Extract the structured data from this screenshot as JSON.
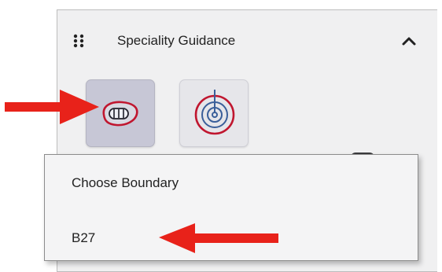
{
  "panel": {
    "title": "Speciality Guidance",
    "drag_icon": "drag-handle-icon",
    "collapse_icon": "chevron-up-icon"
  },
  "tools": [
    {
      "name": "boundary-tool",
      "icon": "boundary-shape-icon",
      "selected": true
    },
    {
      "name": "target-tool",
      "icon": "target-icon",
      "selected": false
    }
  ],
  "dropdown": {
    "header": "Choose Boundary",
    "options": [
      "B27"
    ]
  },
  "annotations": {
    "arrow_color": "#e8221a"
  },
  "colors": {
    "panel_bg": "#f0f0f1",
    "selected_tool_bg": "#c7c7d6",
    "tool_bg": "#e6e6ea",
    "icon_red": "#c0162f",
    "icon_blue": "#3a5f9a"
  }
}
